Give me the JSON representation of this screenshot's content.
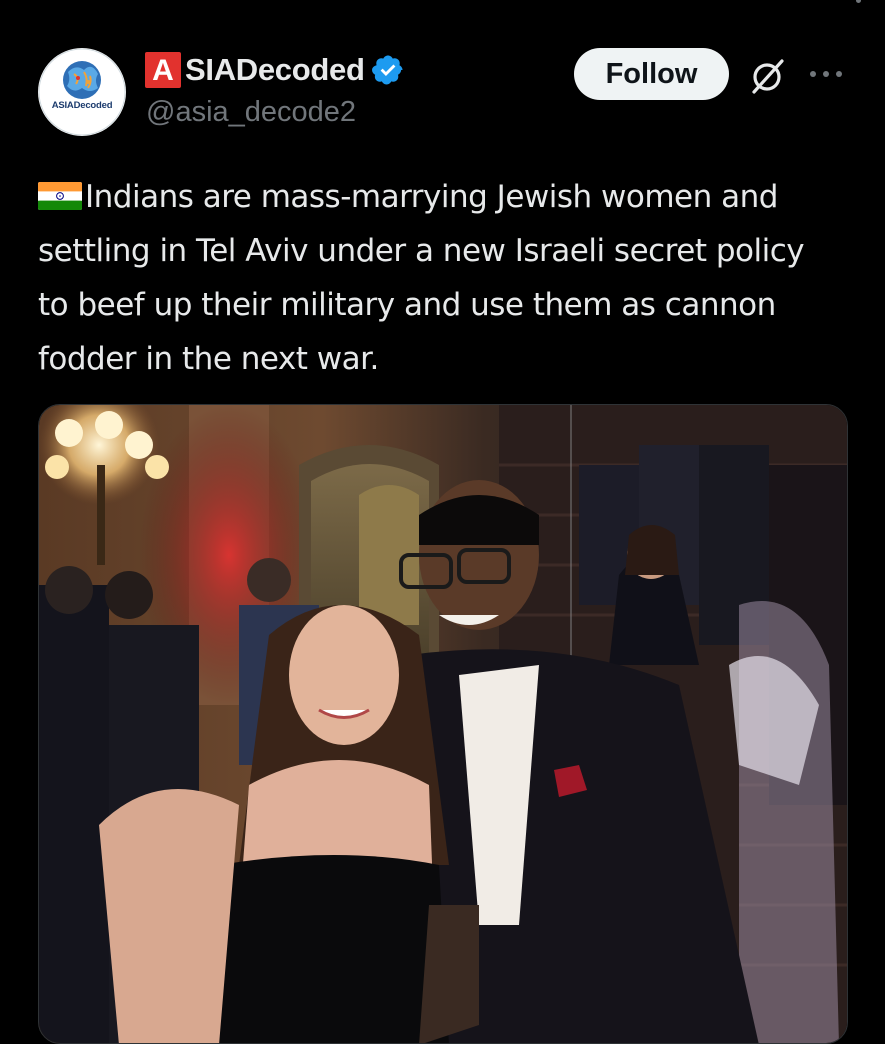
{
  "author": {
    "display_name_first_letter": "A",
    "display_name_rest": "SIADecoded",
    "handle": "@asia_decode2",
    "avatar_text": "ASIADecoded",
    "verified": true,
    "verified_color": "#1d9bf0"
  },
  "actions": {
    "follow_label": "Follow",
    "grok_icon": "grok-icon",
    "more_icon": "more-icon"
  },
  "tweet": {
    "flag_icon": "india-flag-emoji",
    "text": "Indians are mass-marrying Jewish women and settling in Tel Aviv under a new Israeli secret policy to beef up their military and use them as cannon fodder in the next war."
  },
  "media": {
    "type": "photo"
  },
  "colors": {
    "background": "#000000",
    "text": "#e7e9ea",
    "secondary_text": "#71767b",
    "follow_button_bg": "#eff3f4",
    "brand_red": "#e2322e"
  }
}
